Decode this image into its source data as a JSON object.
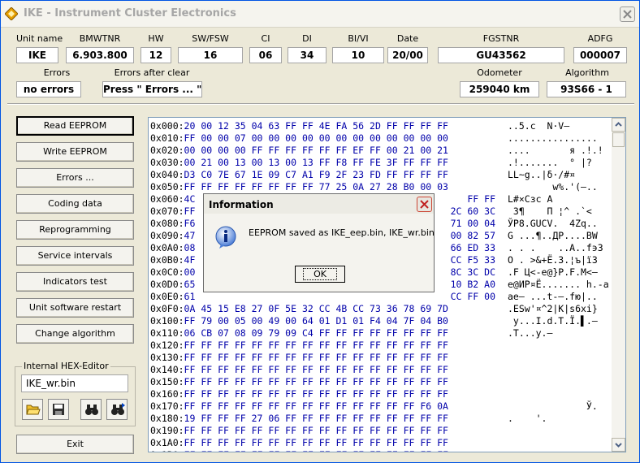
{
  "window": {
    "title": "IKE - Instrument Cluster Electronics"
  },
  "fields_row1": [
    {
      "label": "Unit name",
      "value": "IKE"
    },
    {
      "label": "BMWTNR",
      "value": "6.903.800"
    },
    {
      "label": "HW",
      "value": "12"
    },
    {
      "label": "SW/FSW",
      "value": "16"
    },
    {
      "label": "CI",
      "value": "06"
    },
    {
      "label": "DI",
      "value": "34"
    },
    {
      "label": "BI/VI",
      "value": "10"
    },
    {
      "label": "Date",
      "value": "20/00"
    },
    {
      "label": "FGSTNR",
      "value": "GU43562"
    },
    {
      "label": "ADFG",
      "value": "000007"
    }
  ],
  "fields_row2": [
    {
      "label": "Errors",
      "value": "no errors"
    },
    {
      "label": "Errors after clear",
      "value": "Press \" Errors ... \""
    },
    {
      "label": "Odometer",
      "value": "259040 km"
    },
    {
      "label": "Algorithm",
      "value": "93S66 - 1"
    }
  ],
  "buttons": [
    "Read EEPROM",
    "Write EEPROM",
    "Errors ...",
    "Coding data",
    "Reprogramming",
    "Service intervals",
    "Indicators test",
    "Unit software restart",
    "Change algorithm"
  ],
  "hex_editor": {
    "group_label": "Internal HEX-Editor",
    "filename": "IKE_wr.bin",
    "tool_icons": [
      "open-folder-icon",
      "save-disk-icon",
      "binoculars-find-icon",
      "binoculars-find-next-icon"
    ]
  },
  "exit_label": "Exit",
  "hex_rows": [
    {
      "addr": "0x000:",
      "hex": "20 00 12 35 04 63 FF FF 4E FA 56 2D FF FF FF FF",
      "ascii": "..5.c  N·V–"
    },
    {
      "addr": "0x010:",
      "hex": "FF 00 00 07 00 00 00 00 00 00 00 00 00 00 00 00",
      "ascii": "................"
    },
    {
      "addr": "0x020:",
      "hex": "00 00 00 00 FF FF FF FF FF FF EF FF 00 21 00 21",
      "ascii": "....       я .!.!"
    },
    {
      "addr": "0x030:",
      "hex": "00 21 00 13 00 13 00 13 FF F8 FF FE 3F FF FF FF",
      "ascii": ".!.......  ° |?"
    },
    {
      "addr": "0x040:",
      "hex": "D3 C0 7E 67 1E 09 C7 A1 F9 2F 23 FD FF FF FF FF",
      "ascii": "LL~g..|δ·/#¤"
    },
    {
      "addr": "0x050:",
      "hex": "FF FF FF FF FF FF FF FF 77 25 0A 27 28 B0 00 03",
      "ascii": "        w%.'(–.."
    },
    {
      "addr": "0x060:",
      "hex": "4C",
      "ascii": "L#×Cзc A"
    },
    {
      "addr": "0x070:",
      "hex": "FF",
      "ascii": " З¶    П ¦^ .`<"
    },
    {
      "addr": "0x080:",
      "hex": "F6",
      "ascii": "ЎP8.GUCV.  4Zq.."
    },
    {
      "addr": "0x090:",
      "hex": "47",
      "ascii": "G ...¶..ДР....BW"
    },
    {
      "addr": "0x0A0:",
      "hex": "08",
      "ascii": ". . .    ..A..f϶3"
    },
    {
      "addr": "0x0B0:",
      "hex": "4F",
      "ascii": "O . >&+Ё.3.¦ъ|ї3"
    },
    {
      "addr": "0x0C0:",
      "hex": "00",
      "ascii": ".F Ц<-e@}P.F.M<–"
    },
    {
      "addr": "0x0D0:",
      "hex": "65",
      "ascii": "e@ИР¤Ё....... h.-a"
    },
    {
      "addr": "0x0E0:",
      "hex": "61",
      "ascii": "ae– ...t-–.fю|.."
    },
    {
      "addr": "0x0F0:",
      "hex": "0A 45 15 E8 27 0F 5E 32 CC 4B CC 73 36 78 69 7D",
      "ascii": ".ESw'¤^2|K|s6xi}"
    },
    {
      "addr": "0x100:",
      "hex": "FF 79 00 05 00 49 00 64 01 D1 01 F4 04 7F 04 B0",
      "ascii": " y...I.d.T.Ї.▌.–"
    },
    {
      "addr": "0x110:",
      "hex": "06 CB 07 08 09 79 09 C4 FF FF FF FF FF FF FF FF",
      "ascii": ".T...y.–"
    },
    {
      "addr": "0x120:",
      "hex": "FF FF FF FF FF FF FF FF FF FF FF FF FF FF FF FF",
      "ascii": ""
    },
    {
      "addr": "0x130:",
      "hex": "FF FF FF FF FF FF FF FF FF FF FF FF FF FF FF FF",
      "ascii": ""
    },
    {
      "addr": "0x140:",
      "hex": "FF FF FF FF FF FF FF FF FF FF FF FF FF FF FF FF",
      "ascii": ""
    },
    {
      "addr": "0x150:",
      "hex": "FF FF FF FF FF FF FF FF FF FF FF FF FF FF FF FF",
      "ascii": ""
    },
    {
      "addr": "0x160:",
      "hex": "FF FF FF FF FF FF FF FF FF FF FF FF FF FF FF FF",
      "ascii": ""
    },
    {
      "addr": "0x170:",
      "hex": "FF FF FF FF FF FF FF FF FF FF FF FF FF FF F6 0A",
      "ascii": "              Ў."
    },
    {
      "addr": "0x180:",
      "hex": "19 FF FF FF 27 06 FF FF FF FF FF FF FF FF FF FF",
      "ascii": ".    '."
    },
    {
      "addr": "0x190:",
      "hex": "FF FF FF FF FF FF FF FF FF FF FF FF FF FF FF FF",
      "ascii": ""
    },
    {
      "addr": "0x1A0:",
      "hex": "FF FF FF FF FF FF FF FF FF FF FF FF FF FF FF FF",
      "ascii": ""
    },
    {
      "addr": "0x1B0:",
      "hex": "FF FF FF FF FF FF FF FF FF FF FF FF FF FF FF FF",
      "ascii": ""
    }
  ],
  "hex_rows_partial_right": [
    {
      "row": 6,
      "hex": "FF FF"
    },
    {
      "row": 7,
      "hex": "2C 60 3C"
    },
    {
      "row": 8,
      "hex": "71 00 04"
    },
    {
      "row": 9,
      "hex": "00 82 57"
    },
    {
      "row": 10,
      "hex": "66 ED 33"
    },
    {
      "row": 11,
      "hex": "CC F5 33"
    },
    {
      "row": 12,
      "hex": "8C 3C DC"
    },
    {
      "row": 13,
      "hex": "10 B2 A0"
    },
    {
      "row": 14,
      "hex": "CC FF 00"
    }
  ],
  "dialog": {
    "title": "Information",
    "message": "EEPROM saved as IKE_eep.bin, IKE_wr.bin",
    "ok_label": "OK"
  }
}
